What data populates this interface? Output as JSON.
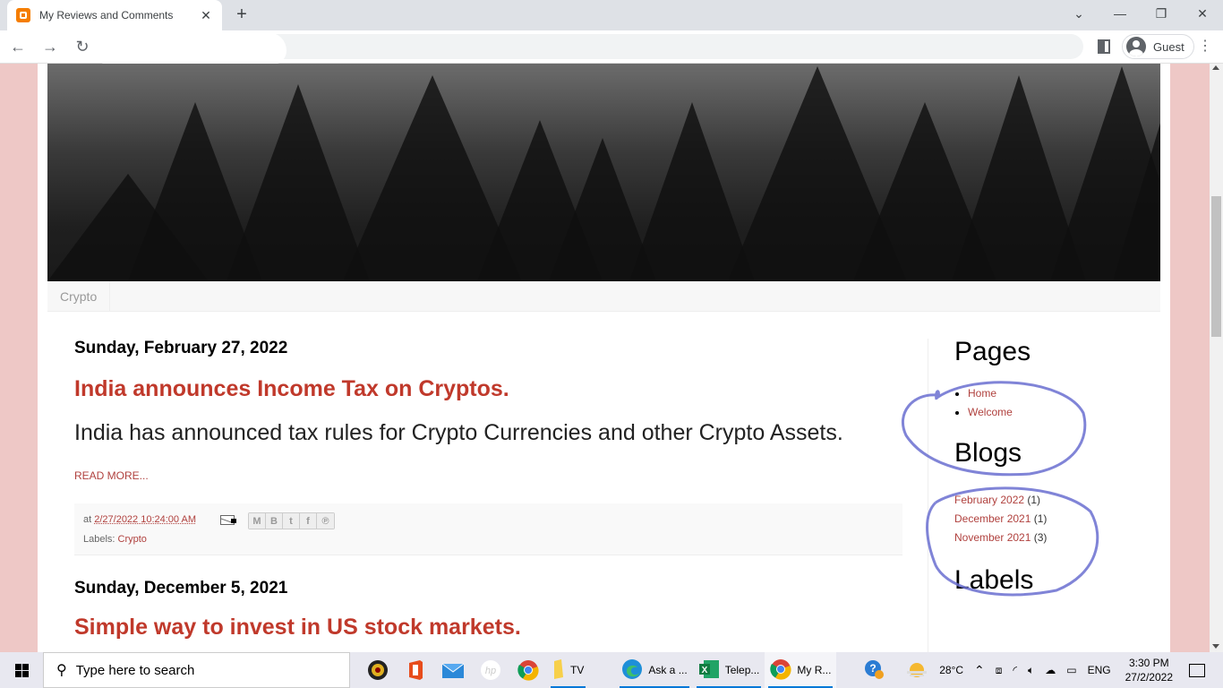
{
  "browser": {
    "tab_title": "My Reviews and Comments",
    "tab_close": "✕",
    "new_tab": "+",
    "window_controls": {
      "dropdown": "⌄",
      "minimize": "—",
      "restore": "❐",
      "close": "✕"
    },
    "nav": {
      "back": "←",
      "forward": "→",
      "reload": "↻"
    },
    "profile_label": "Guest",
    "menu": "⋮"
  },
  "blog": {
    "page_tabs": [
      "Crypto"
    ],
    "posts": [
      {
        "date": "Sunday, February 27, 2022",
        "title": "India announces Income Tax on Cryptos.",
        "snippet": "India has announced tax rules for Crypto Currencies and other Crypto Assets.",
        "read_more": "READ MORE...",
        "footer": {
          "at_prefix": "at ",
          "timestamp": "2/27/2022 10:24:00 AM",
          "labels_prefix": "Labels: ",
          "label": "Crypto"
        }
      },
      {
        "date": "Sunday, December 5, 2021",
        "title": "Simple way to invest in US stock markets."
      }
    ],
    "share_buttons": [
      {
        "name": "email-share",
        "glyph": "M"
      },
      {
        "name": "blogger-share",
        "glyph": "B"
      },
      {
        "name": "twitter-share",
        "glyph": "t"
      },
      {
        "name": "facebook-share",
        "glyph": "f"
      },
      {
        "name": "pinterest-share",
        "glyph": "℗"
      }
    ],
    "sidebar": {
      "pages_title": "Pages",
      "pages": [
        "Home",
        "Welcome"
      ],
      "blogs_title": "Blogs",
      "archive": [
        {
          "label": "February 2022",
          "count": "(1)"
        },
        {
          "label": "December 2021",
          "count": "(1)"
        },
        {
          "label": "November 2021",
          "count": "(3)"
        }
      ],
      "labels_title": "Labels"
    },
    "colors": {
      "link": "#b0413e",
      "title": "#c0392b",
      "page_bg": "#eec8c6",
      "annotation": "#6a6fd0"
    }
  },
  "taskbar": {
    "search_placeholder": "Type here to search",
    "apps": [
      {
        "name": "file-explorer-tv",
        "label": "TV"
      },
      {
        "name": "edge-ask",
        "label": "Ask a ..."
      },
      {
        "name": "excel-telep",
        "label": "Telep..."
      },
      {
        "name": "chrome-my-reviews",
        "label": "My R..."
      }
    ],
    "weather": "28°C",
    "language": "ENG",
    "time": "3:30 PM",
    "date": "27/2/2022"
  }
}
